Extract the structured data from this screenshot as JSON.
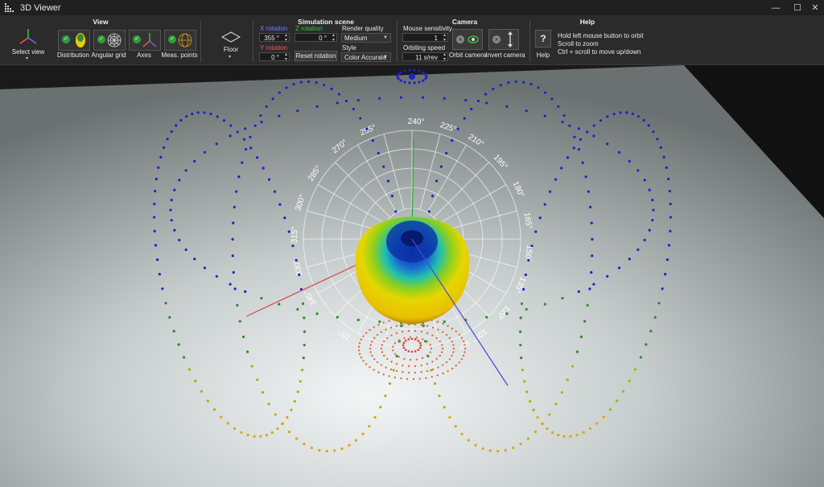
{
  "window": {
    "title": "3D Viewer",
    "controls": [
      "—",
      "☐",
      "✕"
    ]
  },
  "ribbon": {
    "view": {
      "title": "View",
      "select_view": "Select view",
      "toggles": [
        {
          "label": "Distribution",
          "checked": true
        },
        {
          "label": "Angular grid",
          "checked": true
        },
        {
          "label": "Axes",
          "checked": true
        },
        {
          "label": "Meas. points",
          "checked": true
        }
      ]
    },
    "floor": {
      "label": "Floor"
    },
    "simulation": {
      "title": "Simulation scene",
      "x_rotation_label": "X rotation",
      "x_rotation_value": "355 °",
      "y_rotation_label": "Y rotation",
      "y_rotation_value": "0 °",
      "z_rotation_label": "Z rotation",
      "z_rotation_value": "0 °",
      "reset_label": "Reset rotation",
      "render_quality_label": "Render quality",
      "render_quality_value": "Medium",
      "style_label": "Style",
      "style_value": "Color Accurate"
    },
    "camera": {
      "title": "Camera",
      "mouse_sensitivity_label": "Mouse sensitivity",
      "mouse_sensitivity_value": "1",
      "orbiting_speed_label": "Orbiting speed",
      "orbiting_speed_value": "11 s/rev",
      "orbit_camera_label": "Orbit camera",
      "invert_camera_label": "Invert camera"
    },
    "help": {
      "title": "Help",
      "button_label": "Help",
      "lines": [
        "Hold left mouse button to orbit",
        "Scroll to zoom",
        "Ctrl + scroll to move up/down"
      ]
    }
  },
  "grid_labels": [
    "240°",
    "225°",
    "210°",
    "195°",
    "180°",
    "165°",
    "150°",
    "135°",
    "120°",
    "105°",
    "90°",
    "15°",
    "345°",
    "330°",
    "315°",
    "300°",
    "285°",
    "270°",
    "255°"
  ],
  "colors": {
    "titlebar": "#202020",
    "ribbon": "#2b2b2b",
    "check": "#2e9d3a",
    "x_label": "#7a7aff",
    "y_label": "#ff5555",
    "z_label": "#39c23e"
  }
}
